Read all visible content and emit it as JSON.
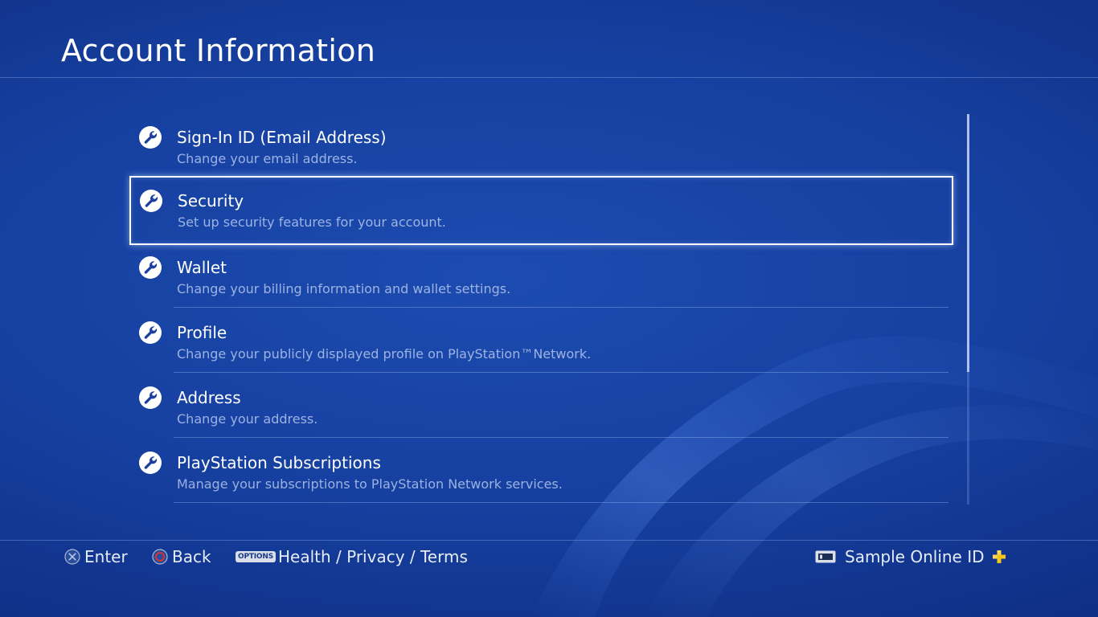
{
  "header": {
    "title": "Account Information"
  },
  "menu": {
    "selected_index": 1,
    "items": [
      {
        "label": "Sign-In ID (Email Address)",
        "description": "Change your email address.",
        "icon": "wrench-icon"
      },
      {
        "label": "Security",
        "description": "Set up security features for your account.",
        "icon": "wrench-icon"
      },
      {
        "label": "Wallet",
        "description": "Change your billing information and wallet settings.",
        "icon": "wrench-icon"
      },
      {
        "label": "Profile",
        "description": "Change your publicly displayed profile on PlayStation™Network.",
        "icon": "wrench-icon"
      },
      {
        "label": "Address",
        "description": "Change your address.",
        "icon": "wrench-icon"
      },
      {
        "label": "PlayStation Subscriptions",
        "description": "Manage your subscriptions to PlayStation Network services.",
        "icon": "wrench-icon"
      }
    ]
  },
  "scrollbar": {
    "visible_fraction": 0.66,
    "position": 0
  },
  "footer": {
    "enter_label": "Enter",
    "enter_icon": "cross-button-icon",
    "back_label": "Back",
    "back_icon": "circle-button-icon",
    "options_badge": "OPTIONS",
    "options_label": "Health / Privacy / Terms",
    "user_label": "Sample Online ID",
    "user_icon": "account-card-icon",
    "plus_icon": "playstation-plus-icon"
  },
  "colors": {
    "background": "#1640a0",
    "accent_plus": "#f5c518",
    "circle_button": "#d6322e"
  }
}
